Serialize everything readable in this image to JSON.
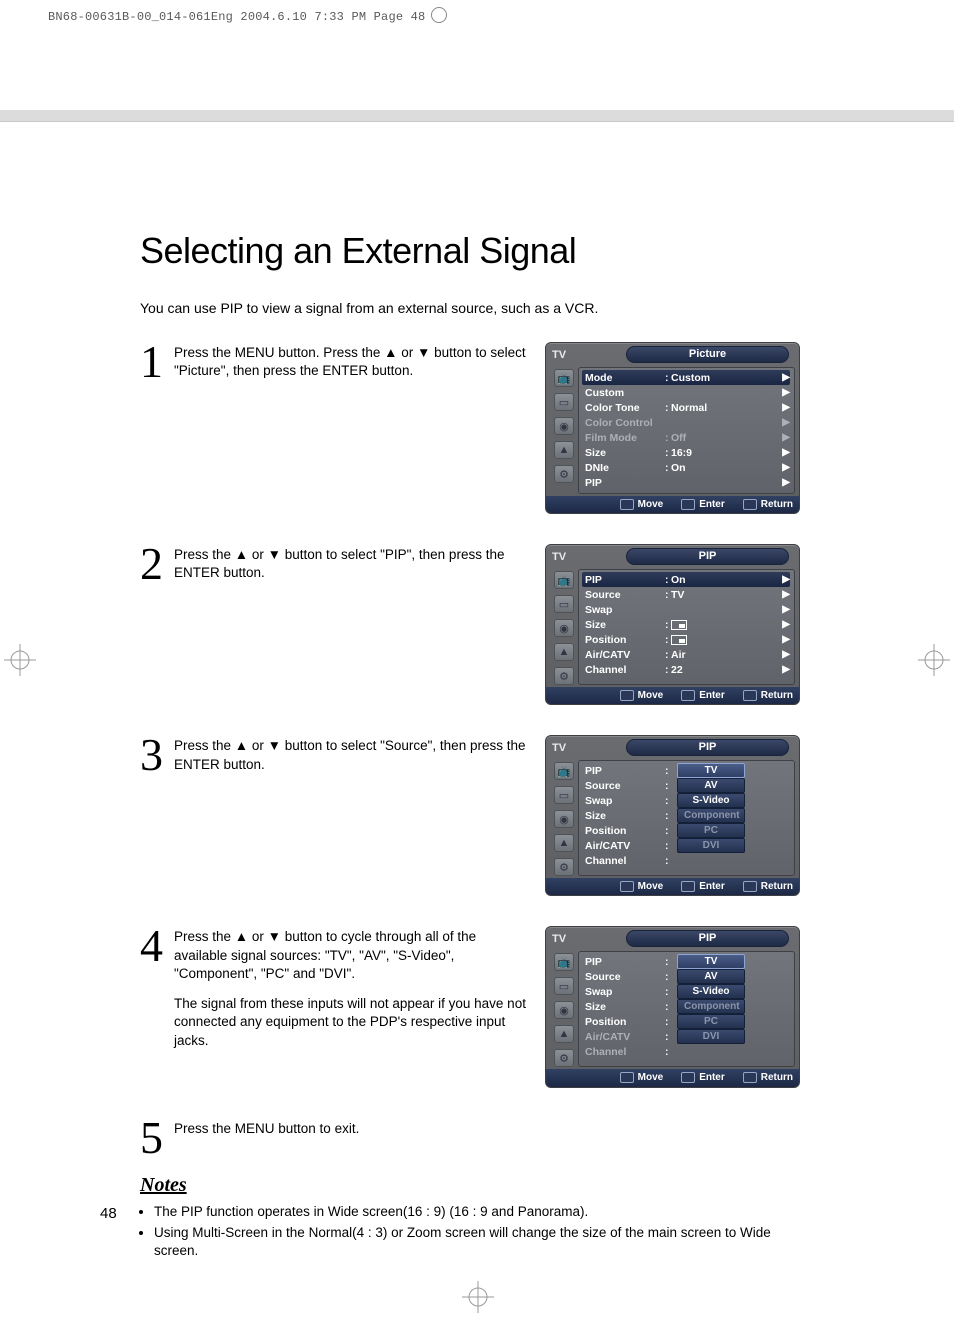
{
  "metaLine": "BN68-00631B-00_014-061Eng  2004.6.10  7:33 PM  Page 48",
  "title": "Selecting an External Signal",
  "intro": "You can use PIP to view a signal from an external source, such as a VCR.",
  "pageNumber": "48",
  "steps": [
    {
      "num": "1",
      "text": "Press the MENU button. Press the ▲ or ▼ button to select \"Picture\", then press the ENTER button."
    },
    {
      "num": "2",
      "text": "Press the ▲ or ▼ button to select \"PIP\", then press the ENTER button."
    },
    {
      "num": "3",
      "text": "Press the ▲ or ▼ button to select \"Source\", then press the ENTER button."
    },
    {
      "num": "4",
      "text": "Press the ▲ or ▼ button to cycle through all of the available signal sources:\n\"TV\", \"AV\", \"S-Video\", \"Component\", \"PC\" and \"DVI\".",
      "text2": "The signal from these inputs will not appear if you have not connected any equipment to the PDP's respective input jacks."
    },
    {
      "num": "5",
      "text": "Press the MENU button to exit."
    }
  ],
  "osdCommon": {
    "tvLabel": "TV",
    "footer": {
      "move": "Move",
      "enter": "Enter",
      "return": "Return"
    },
    "moveGlyph": "✥",
    "arrow": "▶"
  },
  "osd1": {
    "title": "Picture",
    "rows": [
      {
        "label": "Mode",
        "value": "Custom",
        "sel": true
      },
      {
        "label": "Custom",
        "value": ""
      },
      {
        "label": "Color Tone",
        "value": "Normal"
      },
      {
        "label": "Color Control",
        "value": "",
        "dim": true
      },
      {
        "label": "Film Mode",
        "value": "Off",
        "dim": true
      },
      {
        "label": "Size",
        "value": "16:9"
      },
      {
        "label": "DNIe",
        "value": "On"
      },
      {
        "label": "PIP",
        "value": ""
      }
    ]
  },
  "osd2": {
    "title": "PIP",
    "rows": [
      {
        "label": "PIP",
        "value": "On",
        "sel": true
      },
      {
        "label": "Source",
        "value": "TV"
      },
      {
        "label": "Swap",
        "value": ""
      },
      {
        "label": "Size",
        "value": "",
        "icon": true
      },
      {
        "label": "Position",
        "value": "",
        "icon": true
      },
      {
        "label": "Air/CATV",
        "value": "Air"
      },
      {
        "label": "Channel",
        "value": "22"
      }
    ]
  },
  "osd3": {
    "title": "PIP",
    "left": [
      "PIP",
      "Source",
      "Swap",
      "Size",
      "Position",
      "Air/CATV",
      "Channel"
    ],
    "opts": [
      {
        "label": "TV",
        "sel": true
      },
      {
        "label": "AV"
      },
      {
        "label": "S-Video"
      },
      {
        "label": "Component",
        "dim": true
      },
      {
        "label": "PC",
        "dim": true
      },
      {
        "label": "DVI",
        "dim": true
      }
    ]
  },
  "osd4": {
    "title": "PIP",
    "left": [
      "PIP",
      "Source",
      "Swap",
      "Size",
      "Position",
      "Air/CATV",
      "Channel"
    ],
    "dimIdx": [
      5,
      6
    ],
    "opts": [
      {
        "label": "TV",
        "sel": true
      },
      {
        "label": "AV"
      },
      {
        "label": "S-Video"
      },
      {
        "label": "Component",
        "dim": true
      },
      {
        "label": "PC",
        "dim": true
      },
      {
        "label": "DVI",
        "dim": true
      }
    ]
  },
  "notesHead": "Notes",
  "notes": [
    "The PIP function operates in Wide screen(16 : 9) (16 : 9 and Panorama).",
    "Using Multi-Screen in the Normal(4 : 3) or Zoom screen will change the size of the main screen to Wide screen."
  ]
}
